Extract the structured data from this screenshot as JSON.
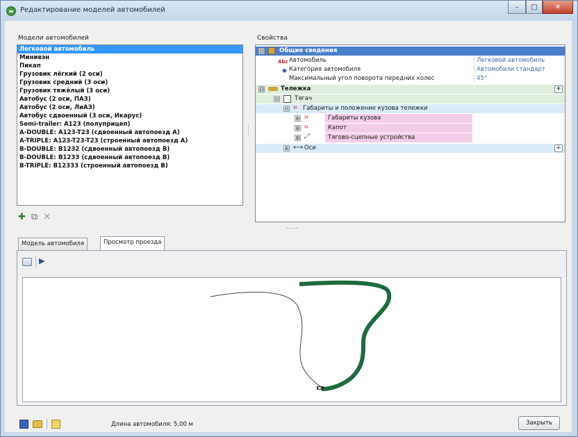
{
  "window": {
    "title": "Редактирование моделей автомобилей",
    "minimize_glyph": "–",
    "maximize_glyph": "□",
    "close_glyph": "✕"
  },
  "models": {
    "label": "Модели автомобилей",
    "items": [
      "Легковой автомобиль",
      "Минивэн",
      "Пикап",
      "Грузовик лёгкий (2 оси)",
      "Грузовик средний (3 оси)",
      "Грузовик тяжёлый (3 оси)",
      "Автобус (2 оси, ПАЗ)",
      "Автобус (2 оси, ЛиАЗ)",
      "Автобус сдвоенный (3 оси, Икарус)",
      "Semi-trailer: A123 (полуприцеп)",
      "A-DOUBLE: A123-T23 (сдвоенный автопоезд A)",
      "A-TRIPLE: A123-T23-T23 (строенный автопоезд A)",
      "B-DOUBLE: B1232 (сдвоенный автопоезд B)",
      "B-DOUBLE: B1233 (сдвоенный автопоезд B)",
      "B-TRIPLE: B12333 (строенный автопоезд B)"
    ],
    "selected_index": 0,
    "tools": {
      "add_glyph": "✚",
      "copy_glyph": "⧉",
      "delete_glyph": "✕"
    }
  },
  "properties": {
    "label": "Свойства",
    "general": {
      "header": "Общие сведения",
      "rows": [
        {
          "name": "Автомобиль",
          "value": "Легковой автомобиль"
        },
        {
          "name": "Категория автомобиля",
          "value": "Автомобили стандарт"
        },
        {
          "name": "Максимальный угол поворота передних колес",
          "value": "45°"
        }
      ]
    },
    "carts": {
      "header": "Тележка",
      "tractor": "Тягач",
      "body_group": "Габариты и положение кузова тележки",
      "body_items": [
        "Габариты кузова",
        "Капот",
        "Тягово-сцепные устройства"
      ],
      "axles": "Оси"
    },
    "expand_glyph": "⊞",
    "collapse_glyph": "⊟",
    "add_glyph": "+"
  },
  "tabs": [
    {
      "label": "Модель автомобиля",
      "active": false
    },
    {
      "label": "Просмотр проезда",
      "active": true
    }
  ],
  "preview": {
    "play_glyph": "▶"
  },
  "footer": {
    "vehicle_length": "Длина автомобиля: 5,00 м",
    "close_label": "Закрыть"
  },
  "colors": {
    "selection": "#3399ff",
    "general_header": "#4a7fc9",
    "cart_row": "#dfeedd",
    "body_group_row": "#d9ebf7",
    "body_item_row": "#f2cde8",
    "path_fill": "#1e6b3c"
  }
}
